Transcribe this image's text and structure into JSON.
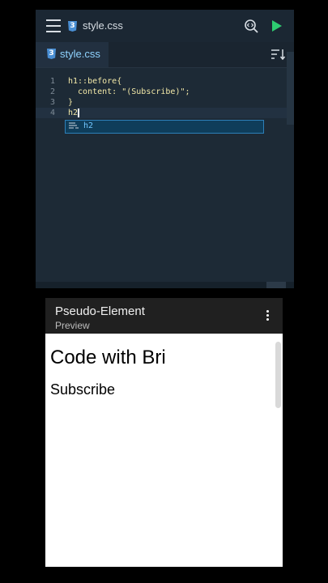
{
  "editor": {
    "filename": "style.css",
    "tab_label": "style.css",
    "icons": [
      "menu-icon",
      "css-file-icon",
      "search-code-icon",
      "run-icon",
      "sort-icon"
    ],
    "lines": [
      {
        "num": "1",
        "text": "h1::before{"
      },
      {
        "num": "2",
        "text": "  content: \"(Subscribe)\";"
      },
      {
        "num": "3",
        "text": "}"
      },
      {
        "num": "4",
        "text": "h2"
      }
    ],
    "autocomplete": "h2"
  },
  "preview": {
    "title": "Pseudo-Element",
    "subtitle": "Preview",
    "h1": "Code with Bri",
    "h2": "Subscribe"
  },
  "colors": {
    "run": "#2ecc71",
    "accent": "#8fd3ff",
    "code": "#f3e9a8"
  }
}
